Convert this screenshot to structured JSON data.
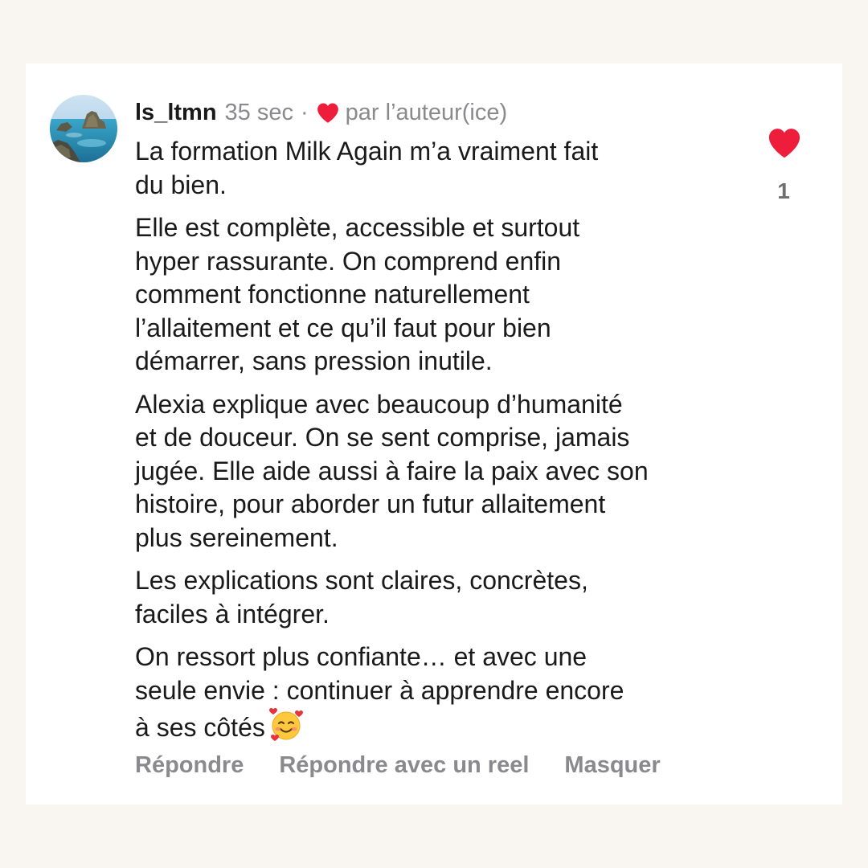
{
  "comment": {
    "username": "ls_ltmn",
    "time": "35 sec",
    "separator": "·",
    "author_liked_label": "par l’auteur(ice)",
    "paragraphs": [
      "La formation Milk Again  m’a vraiment fait\ndu bien.",
      "Elle est complète, accessible et surtout\nhyper rassurante. On comprend enfin\ncomment fonctionne naturellement\nl’allaitement et ce qu’il faut pour bien\ndémarrer, sans pression inutile.",
      "Alexia explique avec beaucoup d’humanité\net de douceur. On se sent comprise, jamais\njugée. Elle aide aussi à faire la paix avec son\nhistoire, pour aborder un futur allaitement\nplus sereinement.",
      "Les explications sont claires, concrètes,\nfaciles à intégrer.",
      "On ressort plus confiante… et avec une\nseule envie : continuer à apprendre encore\nà ses côtés"
    ],
    "emoji": "smiling-face-with-hearts",
    "like_count": "1",
    "liked": true
  },
  "actions": {
    "reply": "Répondre",
    "reply_reel": "Répondre avec un reel",
    "hide": "Masquer"
  },
  "colors": {
    "background": "#f9f6f1",
    "card": "#ffffff",
    "text": "#1a1a1a",
    "muted": "#8a8a8e",
    "heart": "#ee1d3b"
  },
  "icons": {
    "avatar": "coastal-rocks-photo",
    "like": "heart-filled-icon",
    "author_like": "heart-filled-icon"
  }
}
